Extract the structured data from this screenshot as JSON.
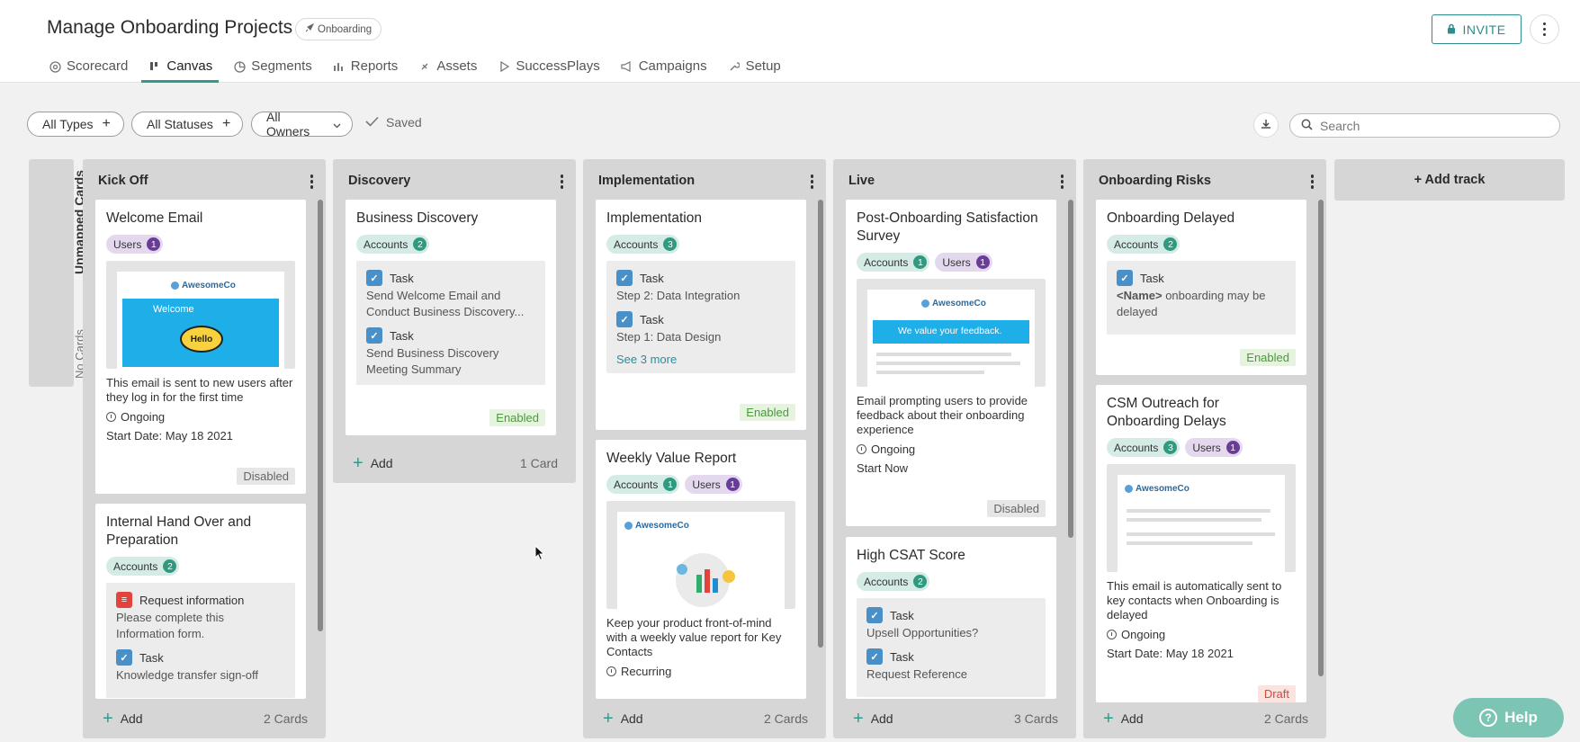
{
  "header": {
    "title": "Manage Onboarding Projects",
    "badge": "Onboarding",
    "invite_label": "INVITE"
  },
  "tabs": [
    {
      "label": "Scorecard",
      "icon": "scorecard-icon"
    },
    {
      "label": "Canvas",
      "icon": "canvas-icon",
      "active": true
    },
    {
      "label": "Segments",
      "icon": "segments-icon"
    },
    {
      "label": "Reports",
      "icon": "reports-icon"
    },
    {
      "label": "Assets",
      "icon": "assets-icon"
    },
    {
      "label": "SuccessPlays",
      "icon": "play-icon"
    },
    {
      "label": "Campaigns",
      "icon": "megaphone-icon"
    },
    {
      "label": "Setup",
      "icon": "wrench-icon"
    }
  ],
  "filters": {
    "types": "All Types",
    "statuses": "All Statuses",
    "owners": "All Owners",
    "saved": "Saved"
  },
  "search": {
    "placeholder": "Search"
  },
  "unmapped": {
    "title": "Unmapped Cards",
    "empty": "No Cards"
  },
  "tracks": [
    {
      "title": "Kick Off",
      "add": "Add",
      "count": "2 Cards",
      "cards": [
        {
          "title": "Welcome Email",
          "chip_users": "Users",
          "users_n": "1",
          "thumb_brand": "AwesomeCo",
          "thumb_banner": "Welcome",
          "thumb_hello": "Hello",
          "desc": "This email is sent to new users after they log in for the first time",
          "schedule": "Ongoing",
          "start": "Start Date: May 18 2021",
          "status": "Disabled"
        },
        {
          "title": "Internal Hand Over and Preparation",
          "chip_accounts": "Accounts",
          "accounts_n": "2",
          "task1_type": "Request information",
          "task1_text": "Please complete this Information form.",
          "task2_type": "Task",
          "task2_text": "Knowledge transfer sign-off"
        }
      ]
    },
    {
      "title": "Discovery",
      "add": "Add",
      "count": "1 Card",
      "cards": [
        {
          "title": "Business Discovery",
          "chip_accounts": "Accounts",
          "accounts_n": "2",
          "task1_type": "Task",
          "task1_text": "Send Welcome Email and Conduct Business Discovery...",
          "task2_type": "Task",
          "task2_text": "Send Business Discovery Meeting Summary",
          "status": "Enabled"
        }
      ]
    },
    {
      "title": "Implementation",
      "add": "Add",
      "count": "2 Cards",
      "cards": [
        {
          "title": "Implementation",
          "chip_accounts": "Accounts",
          "accounts_n": "3",
          "task1_type": "Task",
          "task1_text": "Step 2: Data Integration",
          "task2_type": "Task",
          "task2_text": "Step 1: Data Design",
          "see_more": "See 3 more",
          "status": "Enabled"
        },
        {
          "title": "Weekly Value Report",
          "chip_accounts": "Accounts",
          "accounts_n": "1",
          "chip_users": "Users",
          "users_n": "1",
          "thumb_brand": "AwesomeCo",
          "desc": "Keep your product front-of-mind with a weekly value report for Key Contacts",
          "schedule": "Recurring"
        }
      ]
    },
    {
      "title": "Live",
      "add": "Add",
      "count": "3 Cards",
      "cards": [
        {
          "title": "Post-Onboarding Satisfaction Survey",
          "chip_accounts": "Accounts",
          "accounts_n": "1",
          "chip_users": "Users",
          "users_n": "1",
          "thumb_brand": "AwesomeCo",
          "thumb_banner": "We value your feedback.",
          "desc": "Email prompting users to provide feedback about their onboarding experience",
          "schedule": "Ongoing",
          "start": "Start Now",
          "status": "Disabled"
        },
        {
          "title": "High CSAT Score",
          "chip_accounts": "Accounts",
          "accounts_n": "2",
          "task1_type": "Task",
          "task1_text": "Upsell Opportunities?",
          "task2_type": "Task",
          "task2_text": "Request Reference"
        }
      ]
    },
    {
      "title": "Onboarding Risks",
      "add": "Add",
      "count": "2 Cards",
      "cards": [
        {
          "title": "Onboarding Delayed",
          "chip_accounts": "Accounts",
          "accounts_n": "2",
          "task1_type": "Task",
          "task1_name": "<Name>",
          "task1_text": " onboarding may be delayed",
          "status": "Enabled"
        },
        {
          "title": "CSM Outreach for Onboarding Delays",
          "chip_accounts": "Accounts",
          "accounts_n": "3",
          "chip_users": "Users",
          "users_n": "1",
          "thumb_brand": "AwesomeCo",
          "desc": "This email is automatically sent to key contacts when Onboarding is delayed",
          "schedule": "Ongoing",
          "start": "Start Date: May 18 2021",
          "status": "Draft"
        }
      ]
    }
  ],
  "add_track": "+ Add track",
  "help": "Help",
  "colors": {
    "accent": "#2d9c8c",
    "invite": "#2d8c8c",
    "help": "#7cc4b4"
  }
}
